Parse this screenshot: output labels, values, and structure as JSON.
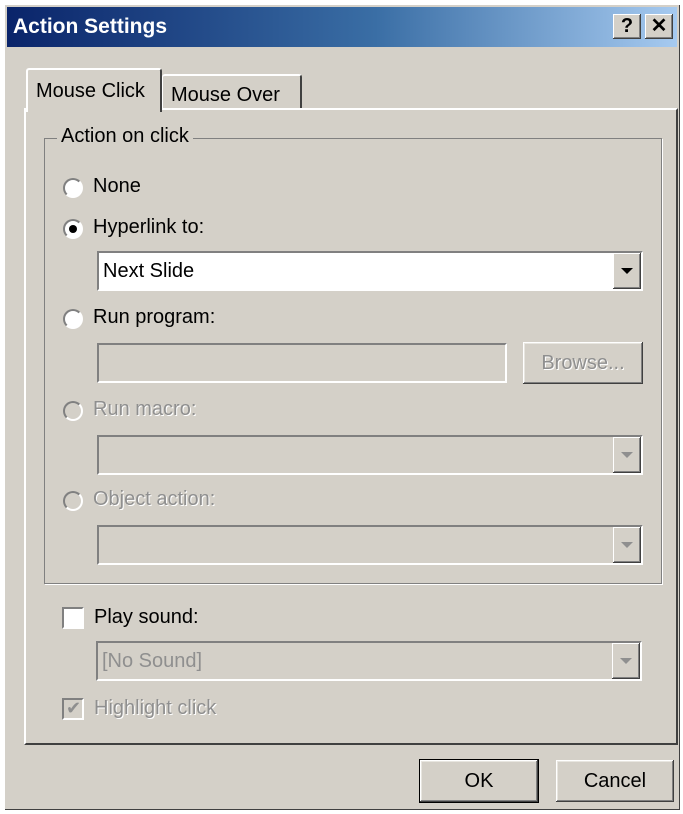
{
  "dialog": {
    "title": "Action Settings",
    "help_label": "?",
    "close_label": "✕"
  },
  "tabs": [
    {
      "label": "Mouse Click",
      "selected": true
    },
    {
      "label": "Mouse Over",
      "selected": false
    }
  ],
  "action_group": {
    "label": "Action on click",
    "options": {
      "none": {
        "label": "None",
        "selected": false,
        "enabled": true
      },
      "hyperlink": {
        "label": "Hyperlink to:",
        "selected": true,
        "enabled": true,
        "value": "Next Slide"
      },
      "run_program": {
        "label": "Run program:",
        "selected": false,
        "enabled": true,
        "value": "",
        "browse_label": "Browse..."
      },
      "run_macro": {
        "label": "Run macro:",
        "selected": false,
        "enabled": false,
        "value": ""
      },
      "object_action": {
        "label": "Object action:",
        "selected": false,
        "enabled": false,
        "value": ""
      }
    }
  },
  "play_sound": {
    "label": "Play sound:",
    "checked": false,
    "value": "[No Sound]"
  },
  "highlight_click": {
    "label": "Highlight click",
    "checked": true,
    "enabled": false
  },
  "buttons": {
    "ok": "OK",
    "cancel": "Cancel"
  },
  "colors": {
    "face": "#d4d0c8",
    "title_start": "#0a246a",
    "title_end": "#a6caf0",
    "disabled_text": "#8f8f8f"
  },
  "icons": {
    "dropdown": "chevron-down-icon",
    "check": "check-icon"
  }
}
